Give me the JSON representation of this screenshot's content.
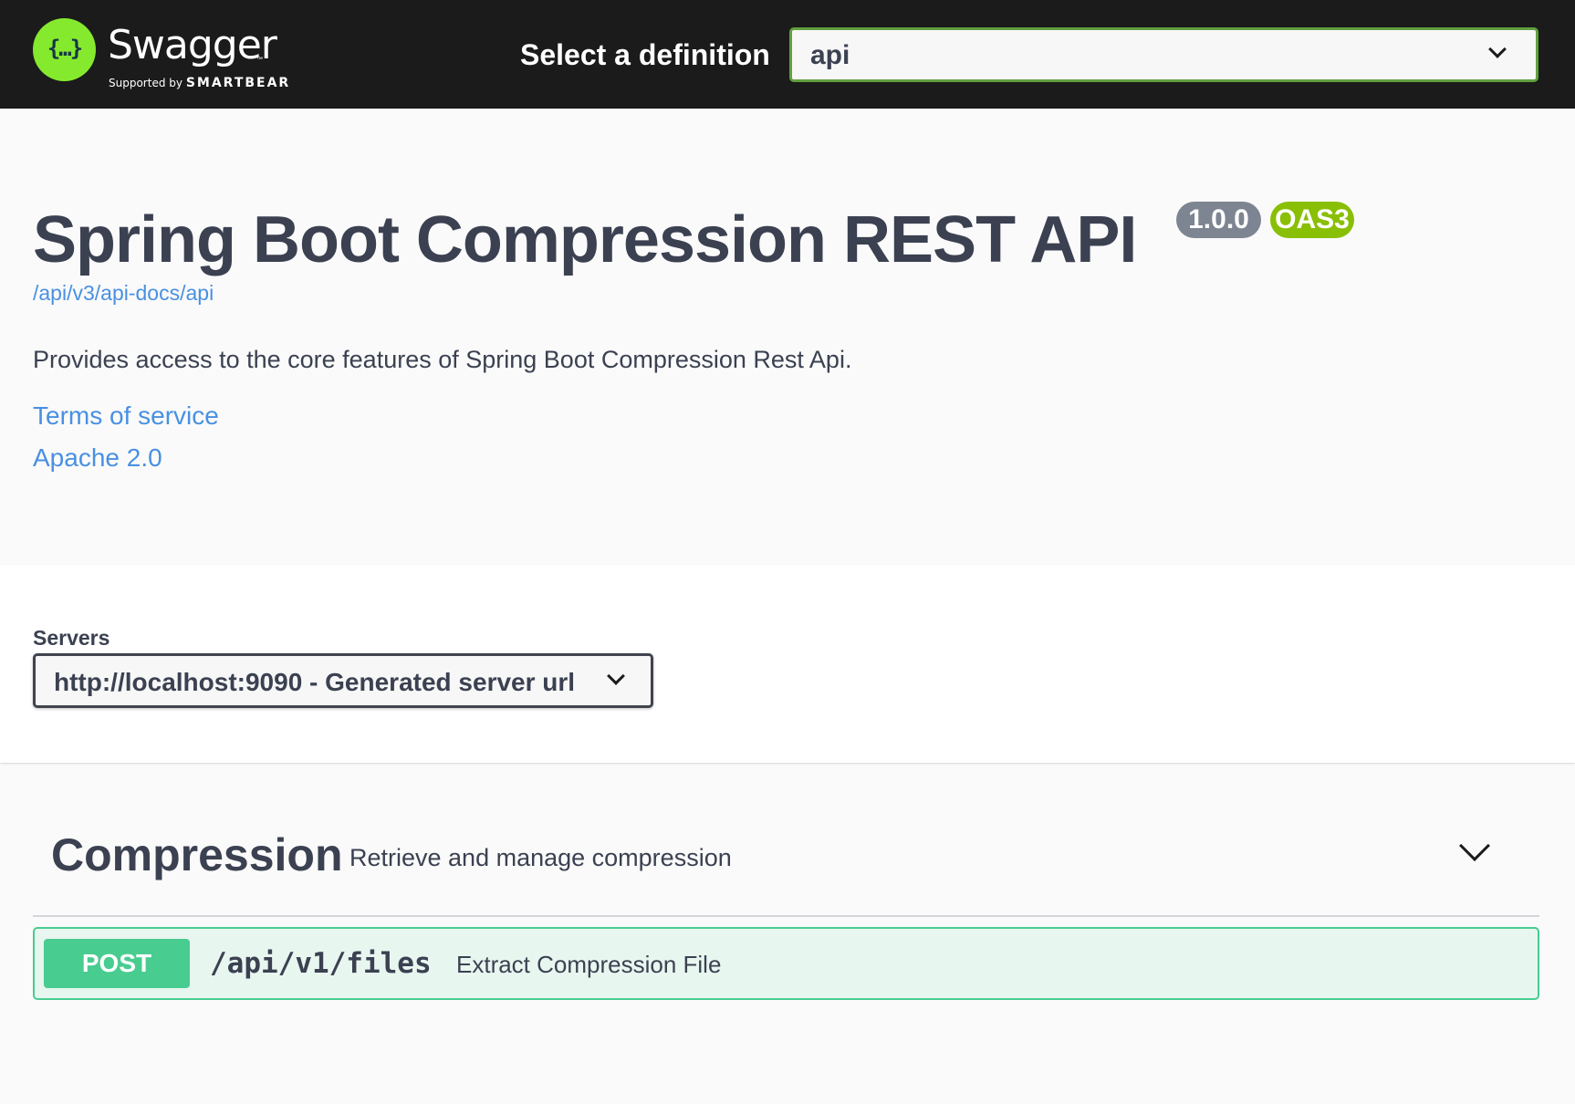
{
  "topbar": {
    "logo_name": "Swagger",
    "logo_tm": "™",
    "logo_glyph": "{…}",
    "logo_sub_prefix": "Supported by",
    "logo_sub_brand": "SMARTBEAR",
    "select_label": "Select a definition",
    "definition_value": "api"
  },
  "info": {
    "title": "Spring Boot Compression REST API",
    "version": "1.0.0",
    "oas": "OAS3",
    "spec_url": "/api/v3/api-docs/api",
    "description": "Provides access to the core features of Spring Boot Compression Rest Api.",
    "terms": "Terms of service",
    "license": "Apache 2.0"
  },
  "servers": {
    "label": "Servers",
    "selected": "http://localhost:9090 - Generated server url"
  },
  "tag": {
    "name": "Compression",
    "description": "Retrieve and manage compression"
  },
  "operations": [
    {
      "method": "POST",
      "path": "/api/v1/files",
      "summary": "Extract Compression File"
    }
  ],
  "colors": {
    "topbar": "#1b1b1b",
    "logo": "#85ea2d",
    "definition_border": "#62a03f",
    "link": "#4990e2",
    "version_badge": "#7d8492",
    "oas_badge": "#89bf04",
    "post": "#49cc90",
    "post_bg": "#e8f6f0"
  },
  "icons": {
    "logo": "swagger-logo-icon",
    "definition_dropdown": "chevron-down-icon",
    "servers_dropdown": "chevron-down-icon",
    "tag_toggle": "chevron-down-icon"
  }
}
